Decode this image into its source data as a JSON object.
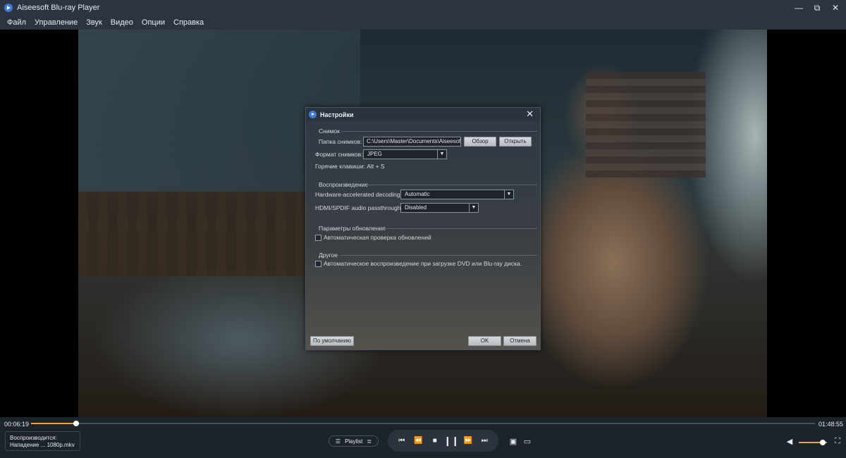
{
  "window": {
    "title": "Aiseesoft Blu-ray Player",
    "minimize": "—",
    "restore": "⧉",
    "close": "✕"
  },
  "menu": [
    "Файл",
    "Управление",
    "Звук",
    "Видео",
    "Опции",
    "Справка"
  ],
  "dialog": {
    "title": "Настройки",
    "close": "✕",
    "snapshot": {
      "heading": "Снимок",
      "folder_label": "Папка снимков:",
      "folder_value": "C:\\Users\\Master\\Documents\\Aiseesoft",
      "browse_label": "Обзор",
      "open_label": "Открыть",
      "format_label": "Формат снимков:",
      "format_value": "JPEG",
      "hotkey_label": "Горячие клавиши: Alt + S"
    },
    "playback": {
      "heading": "Воспроизведение",
      "hw_label": "Hardware-accelerated decoding:",
      "hw_value": "Automatic",
      "hdmi_label": "HDMI/SPDIF audio passthrough:",
      "hdmi_value": "Disabled"
    },
    "update": {
      "heading": "Параметры обновления",
      "auto_check_label": "Автоматическая проверка обновлений",
      "auto_check_checked": false
    },
    "other": {
      "heading": "Другое",
      "autoplay_label": "Автоматическое воспроизведение при загрузке DVD или Blu-ray диска.",
      "autoplay_checked": false
    },
    "default_label": "По умолчанию",
    "ok_label": "OK",
    "cancel_label": "Отмена"
  },
  "player": {
    "elapsed": "00:06:19",
    "total": "01:48:55",
    "progress": 0.058,
    "now_playing_label": "Воспроизводится:",
    "now_playing_file": "Нападение ... 1080p.mkv",
    "playlist_label": "Playlist",
    "volume": 0.85
  },
  "icons": {
    "playlist": "☰",
    "playlist_sort": "≣",
    "prev": "⏮",
    "rewind": "⏪",
    "stop": "■",
    "pause": "❙❙",
    "forward": "⏩",
    "next": "⏭",
    "camera": "▣",
    "folder": "▭",
    "volume": "◀",
    "fullscreen": "⛶",
    "dropdown": "▼"
  }
}
